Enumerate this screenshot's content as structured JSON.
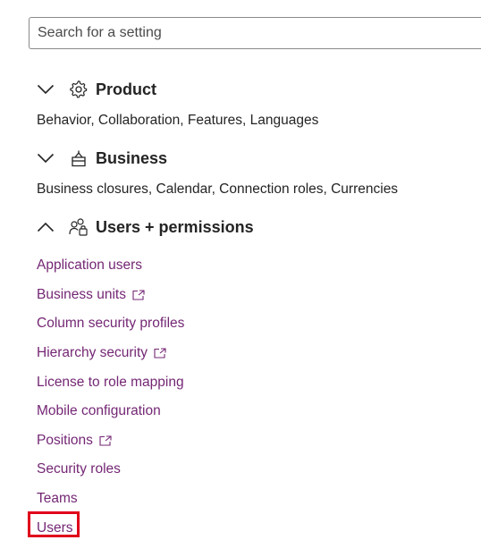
{
  "search": {
    "placeholder": "Search for a setting",
    "value": ""
  },
  "sections": {
    "product": {
      "title": "Product",
      "icon": "gear-icon",
      "expanded": false,
      "summary": "Behavior, Collaboration, Features, Languages"
    },
    "business": {
      "title": "Business",
      "icon": "business-icon",
      "expanded": false,
      "summary": "Business closures, Calendar, Connection roles, Currencies"
    },
    "users": {
      "title": "Users + permissions",
      "icon": "users-lock-icon",
      "expanded": true,
      "items": [
        {
          "label": "Application users",
          "external": false
        },
        {
          "label": "Business units",
          "external": true
        },
        {
          "label": "Column security profiles",
          "external": false
        },
        {
          "label": "Hierarchy security",
          "external": true
        },
        {
          "label": "License to role mapping",
          "external": false
        },
        {
          "label": "Mobile configuration",
          "external": false
        },
        {
          "label": "Positions",
          "external": true
        },
        {
          "label": "Security roles",
          "external": false
        },
        {
          "label": "Teams",
          "external": false
        },
        {
          "label": "Users",
          "external": false,
          "highlighted": true
        }
      ]
    }
  },
  "colors": {
    "link": "#742774",
    "highlight": "#e0001a",
    "text": "#242424"
  }
}
